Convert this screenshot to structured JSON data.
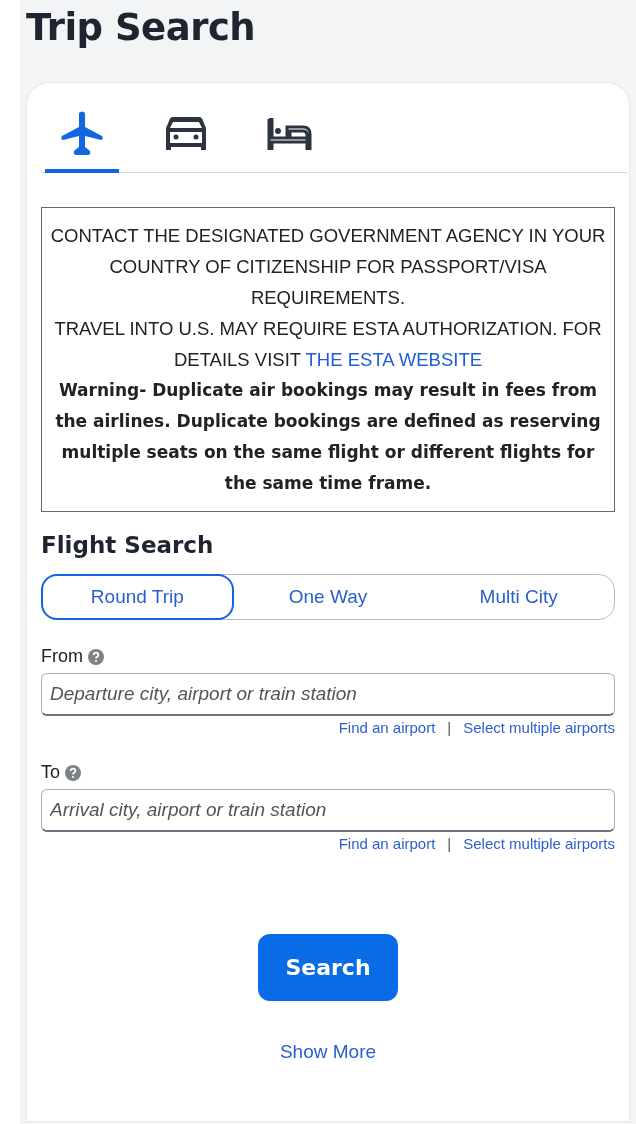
{
  "page_title": "Trip Search",
  "tabs": [
    {
      "kind": "flight",
      "selected": true
    },
    {
      "kind": "car",
      "selected": false
    },
    {
      "kind": "hotel",
      "selected": false
    }
  ],
  "notice": {
    "lines": [
      "CONTACT THE DESIGNATED GOVERNMENT AGENCY IN YOUR COUNTRY OF CITIZENSHIP FOR PASSPORT/VISA REQUIREMENTS."
    ],
    "esta_text": "TRAVEL INTO U.S. MAY REQUIRE ESTA AUTHORIZATION. FOR DETAILS VISIT",
    "esta_link": "THE ESTA WEBSITE",
    "warning": "Warning- Duplicate air bookings may result in fees from the airlines. Duplicate bookings are defined as reserving multiple seats on the same flight or different flights for the same time frame."
  },
  "flight_search": {
    "title": "Flight Search",
    "trip_types": [
      {
        "label": "Round Trip",
        "selected": true
      },
      {
        "label": "One Way",
        "selected": false
      },
      {
        "label": "Multi City",
        "selected": false
      }
    ],
    "fields": [
      {
        "label": "From",
        "placeholder": "Departure city, airport or train station",
        "links": [
          "Find an airport",
          "Select multiple airports"
        ],
        "separator": "|"
      },
      {
        "label": "To",
        "placeholder": "Arrival city, airport or train station",
        "links": [
          "Find an airport",
          "Select multiple airports"
        ],
        "separator": "|"
      }
    ],
    "search_button": "Search",
    "show_more": "Show More"
  }
}
